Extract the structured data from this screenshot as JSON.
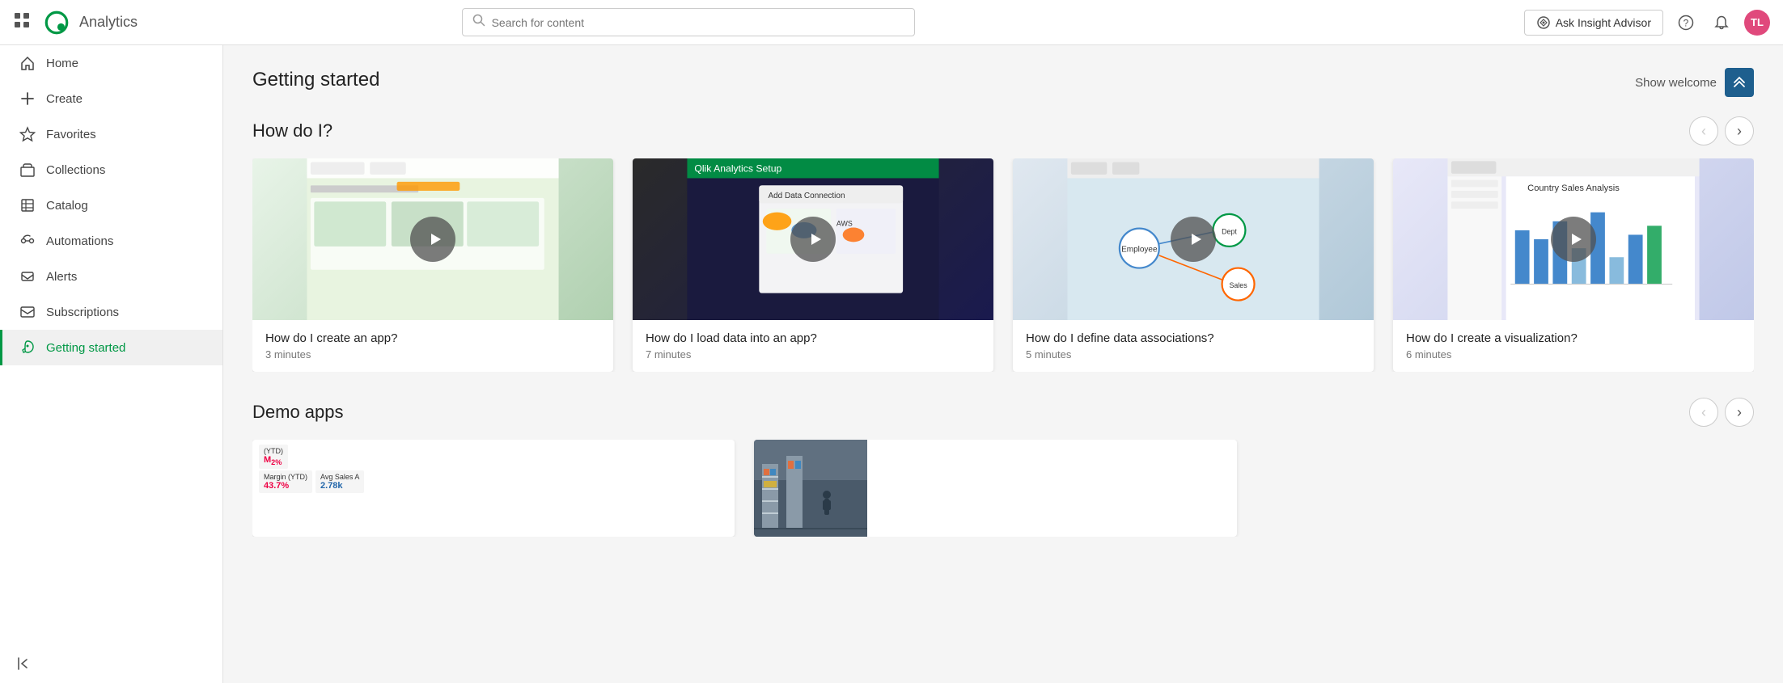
{
  "app": {
    "title": "Analytics",
    "logo_alt": "Qlik"
  },
  "header": {
    "search_placeholder": "Search for content",
    "insight_advisor_label": "Ask Insight Advisor",
    "help_icon": "?",
    "avatar_initials": "TL"
  },
  "sidebar": {
    "items": [
      {
        "id": "home",
        "label": "Home",
        "icon": "home-icon",
        "active": false
      },
      {
        "id": "create",
        "label": "Create",
        "icon": "plus-icon",
        "active": false
      },
      {
        "id": "favorites",
        "label": "Favorites",
        "icon": "star-icon",
        "active": false
      },
      {
        "id": "collections",
        "label": "Collections",
        "icon": "collections-icon",
        "active": false
      },
      {
        "id": "catalog",
        "label": "Catalog",
        "icon": "catalog-icon",
        "active": false
      },
      {
        "id": "automations",
        "label": "Automations",
        "icon": "automations-icon",
        "active": false
      },
      {
        "id": "alerts",
        "label": "Alerts",
        "icon": "alerts-icon",
        "active": false
      },
      {
        "id": "subscriptions",
        "label": "Subscriptions",
        "icon": "subscriptions-icon",
        "active": false
      },
      {
        "id": "getting-started",
        "label": "Getting started",
        "icon": "rocket-icon",
        "active": true
      }
    ],
    "collapse_label": "Collapse"
  },
  "main": {
    "section_title": "Getting started",
    "show_welcome_label": "Show welcome",
    "how_do_i": {
      "heading": "How do I?",
      "prev_disabled": true,
      "next_disabled": false,
      "videos": [
        {
          "title": "How do I create an app?",
          "duration": "3 minutes",
          "thumb_class": "v1"
        },
        {
          "title": "How do I load data into an app?",
          "duration": "7 minutes",
          "thumb_class": "v2"
        },
        {
          "title": "How do I define data associations?",
          "duration": "5 minutes",
          "thumb_class": "v3"
        },
        {
          "title": "How do I create a visualization?",
          "duration": "6 minutes",
          "thumb_class": "v4"
        }
      ]
    },
    "demo_apps": {
      "heading": "Demo apps",
      "prev_disabled": true,
      "next_disabled": false
    }
  },
  "colors": {
    "active_green": "#009845",
    "qlik_green": "#009845",
    "dark_blue": "#1e5f8e",
    "avatar_pink": "#e0497c"
  }
}
